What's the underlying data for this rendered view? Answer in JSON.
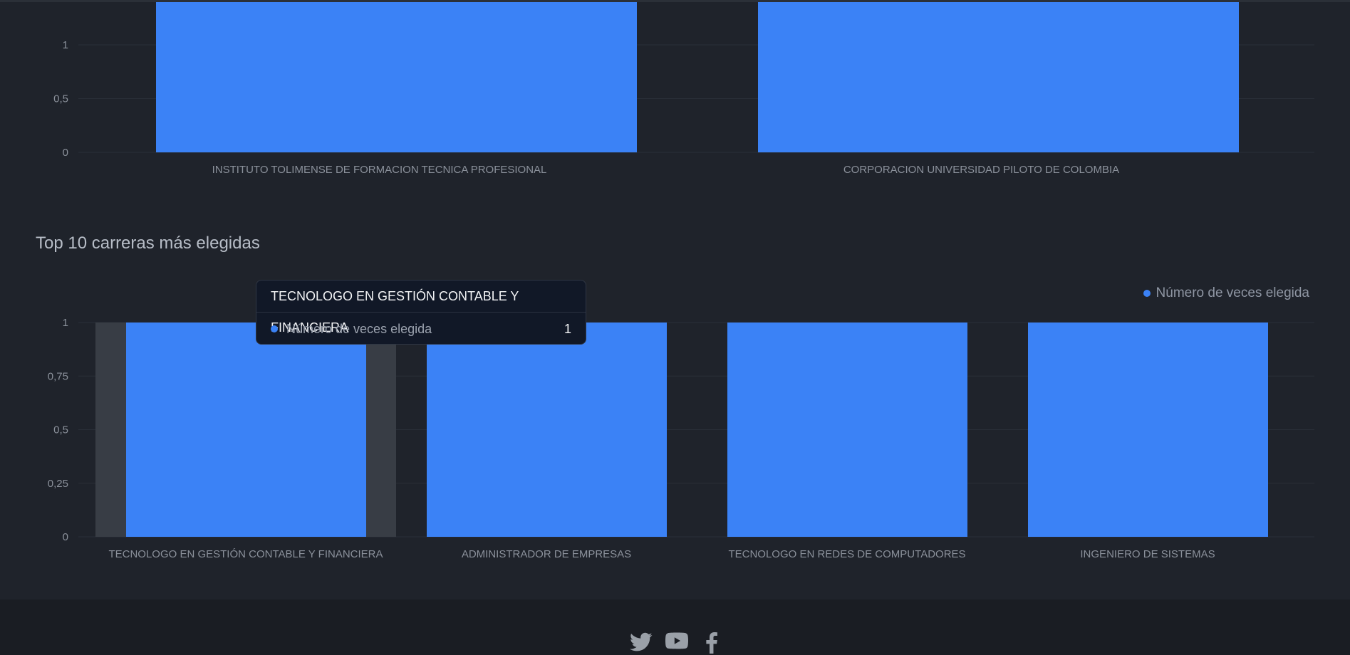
{
  "colors": {
    "bar": "#3b82f6",
    "hover_band": "#383d45",
    "grid": "#2a2f38",
    "tick_text": "#8b919b"
  },
  "section": {
    "title": "Top 10 carreras más elegidas"
  },
  "legend": {
    "label": "Número de veces elegida"
  },
  "tooltip": {
    "title": "TECNOLOGO EN GESTIÓN CONTABLE Y FINANCIERA",
    "series_label": "Número de veces elegida",
    "value": "1"
  },
  "chart_data": [
    {
      "type": "bar",
      "categories": [
        "INSTITUTO TOLIMENSE DE FORMACION TECNICA PROFESIONAL",
        "CORPORACION UNIVERSIDAD PILOTO DE COLOMBIA"
      ],
      "series": [
        {
          "values": [
            1,
            1
          ]
        }
      ],
      "ylim": [
        0,
        1
      ],
      "yticks": [
        0,
        0.5,
        1
      ],
      "ytick_labels": [
        "0",
        "0,5",
        "1"
      ],
      "grid": true
    },
    {
      "type": "bar",
      "title": "Top 10 carreras más elegidas",
      "categories": [
        "TECNOLOGO EN GESTIÓN CONTABLE Y FINANCIERA",
        "ADMINISTRADOR DE EMPRESAS",
        "TECNOLOGO EN REDES DE COMPUTADORES",
        "INGENIERO DE SISTEMAS"
      ],
      "series": [
        {
          "name": "Número de veces elegida",
          "values": [
            1,
            1,
            1,
            1
          ]
        }
      ],
      "ylim": [
        0,
        1
      ],
      "yticks": [
        0,
        0.25,
        0.5,
        0.75,
        1
      ],
      "ytick_labels": [
        "0",
        "0,25",
        "0,5",
        "0,75",
        "1"
      ],
      "grid": true,
      "legend_position": "top-right",
      "highlighted_category": "TECNOLOGO EN GESTIÓN CONTABLE Y FINANCIERA"
    }
  ],
  "footer": {
    "social_icons": [
      "twitter-icon",
      "youtube-icon",
      "facebook-icon"
    ]
  }
}
